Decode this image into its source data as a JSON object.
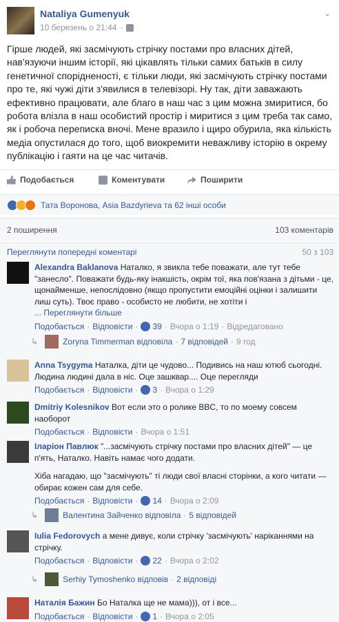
{
  "post": {
    "author": "Nataliya Gumenyuk",
    "date": "10 березень о 21:44",
    "text": "Гірше людей, які засмічують стрічку постами про власних дітей, нав'язуючи іншим історії, які цікавлять тільки самих батьків в силу генетичної спорідненості, є тільки люди, які засмічують стрічку постами про те, які чужі діти з'явилися в телевізорі. Ну так, діти заважають ефективно працювати, але благо в наш час з цим можна змиритися, бо робота влізла в наш особистий простір і миритися з цим треба так само, як і робоча переписка вночі. Мене вразило і щиро обурила, яка кількість медіа опустилася до того, щоб виокремити неважливу історію в окрему публікацію і гаяти на це час читачів."
  },
  "actions": {
    "like": "Подобається",
    "comment": "Коментувати",
    "share": "Поширити"
  },
  "reactions": {
    "names": "Тата Воронова, Asia Bazdyrieva та 62 інші особи",
    "colors": {
      "like": "#4267b2",
      "wow": "#f7b125",
      "angry": "#e9710f"
    }
  },
  "stats": {
    "shares": "2 поширення",
    "comments": "103 коментарів"
  },
  "previous": {
    "label": "Переглянути попередні коментарі",
    "count": "50 з 103"
  },
  "comments": [
    {
      "name": "Alexandra Baklanova",
      "text": "Наталко, я звикла тебе поважати, але тут тебе \"занесло\". Поважати будь-яку інакшість, окрім тої, яка пов'язана з дітьми - це, щонайменше, непослідовно (якщо пропустити емоційні оцінки і залишити лиш суть). Твоє право - особисто не любити, не хотіти і",
      "see_more": "... Переглянути більше",
      "like": "Подобається",
      "reply": "Відповісти",
      "likes": "39",
      "time": "Вчора о 1:19",
      "edited": "Відредаговано",
      "reply_info": {
        "name": "Zoryna Timmerman відповіла",
        "count": "7 відповідей",
        "time": "9 год"
      }
    },
    {
      "name": "Anna Tsygyma",
      "text": "Наталка, діти це чудово... Подивись на наш ютюб сьогодні. Людина людині дала в ніс. Оце зашквар.... Оце перегляди",
      "like": "Подобається",
      "reply": "Відповісти",
      "likes": "3",
      "time": "Вчора о 1:29"
    },
    {
      "name": "Dmitriy Kolesnikov",
      "text": "Вот если это о ролике BBC, то по моему совсем наоборот",
      "like": "Подобається",
      "reply": "Відповісти",
      "time": "Вчора о 1:51"
    },
    {
      "name": "Іларіон Павлюк",
      "text": "\"...засмічують стрічку постами про власних дітей\" — це п'ять, Наталко. Навіть намає чого додати.",
      "text2": "Хіба нагадаю, що \"засмічують\" ті люди свої власні сторінки, а кого читати — обирає кожен сам для себе.",
      "like": "Подобається",
      "reply": "Відповісти",
      "likes": "14",
      "time": "Вчора о 2:09",
      "reply_info": {
        "name": "Валентина Зайченко відповіла",
        "count": "5 відповідей"
      }
    },
    {
      "name": "Iulia Fedorovych",
      "text": "а мене дивує, коли стрічку 'засмічують' наріканнями на стрічку.",
      "like": "Подобається",
      "reply": "Відповісти",
      "likes": "22",
      "time": "Вчора о 2:02",
      "reply_info": {
        "name": "Serhiy Tymoshenko відповів",
        "count": "2 відповіді"
      }
    },
    {
      "name": "Наталія Бажин",
      "text": "Бо Наталка ще не мама))), от і все...",
      "like": "Подобається",
      "reply": "Відповісти",
      "likes": "1",
      "time": "Вчора о 2:05"
    }
  ]
}
